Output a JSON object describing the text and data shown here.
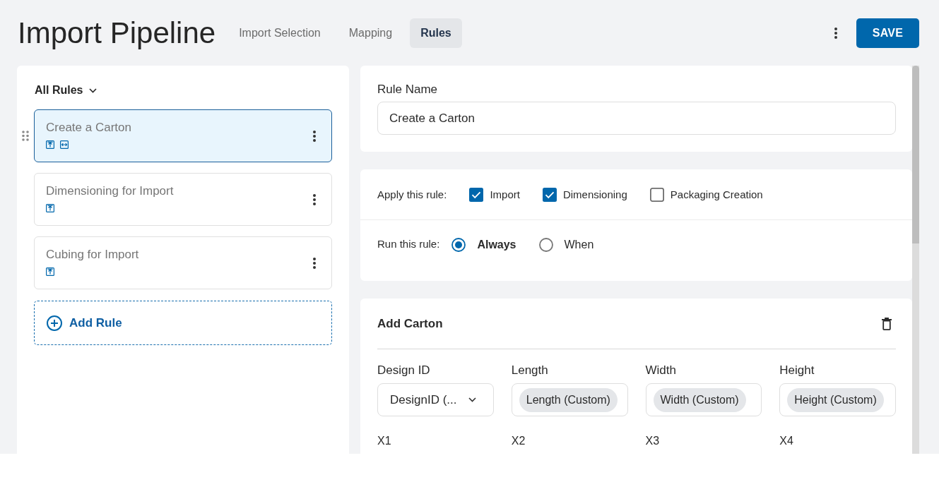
{
  "header": {
    "title": "Import Pipeline",
    "tabs": [
      {
        "label": "Import Selection",
        "selected": false
      },
      {
        "label": "Mapping",
        "selected": false
      },
      {
        "label": "Rules",
        "selected": true
      }
    ],
    "save_button": "SAVE"
  },
  "rules_panel": {
    "filter": "All Rules",
    "rules": [
      {
        "name": "Create a Carton",
        "selected": true,
        "badges": [
          {
            "kind": "import"
          },
          {
            "kind": "dimensioning"
          }
        ]
      },
      {
        "name": "Dimensioning for Import",
        "selected": false,
        "badges": [
          {
            "kind": "import"
          }
        ]
      },
      {
        "name": "Cubing for Import",
        "selected": false,
        "badges": [
          {
            "kind": "import"
          }
        ]
      }
    ],
    "add_button": "Add Rule"
  },
  "rule_name": {
    "label": "Rule Name",
    "value": "Create a Carton"
  },
  "conditions": {
    "apply": {
      "label": "Apply this rule:",
      "options": [
        {
          "label": "Import",
          "checked": true
        },
        {
          "label": "Dimensioning",
          "checked": true
        },
        {
          "label": "Packaging Creation",
          "checked": false
        }
      ]
    },
    "run": {
      "label": "Run this rule:",
      "options": [
        {
          "label": "Always",
          "selected": true
        },
        {
          "label": "When",
          "selected": false
        }
      ]
    }
  },
  "action": {
    "title": "Add Carton",
    "fields": [
      {
        "label": "Design ID",
        "kind": "select",
        "value": "DesignID (...",
        "caption": "X1"
      },
      {
        "label": "Length",
        "kind": "chip",
        "value": "Length (Custom)",
        "caption": "X2"
      },
      {
        "label": "Width",
        "kind": "chip",
        "value": "Width (Custom)",
        "caption": "X3"
      },
      {
        "label": "Height",
        "kind": "chip",
        "value": "Height (Custom)",
        "caption": "X4"
      }
    ]
  }
}
